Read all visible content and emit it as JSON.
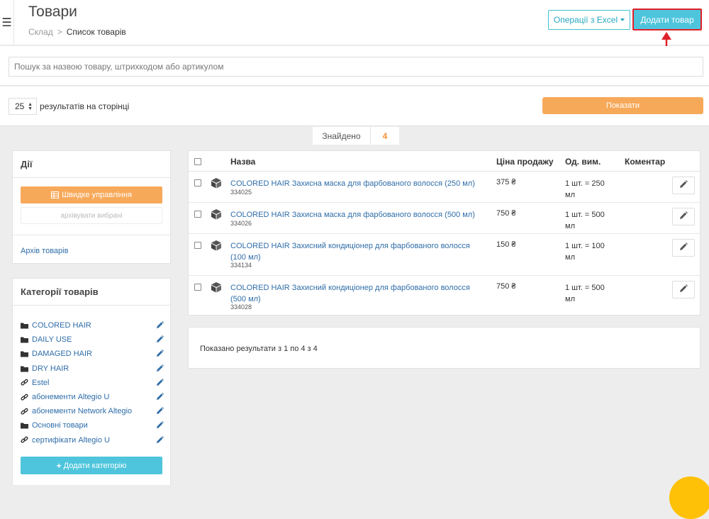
{
  "header": {
    "menu_icon": "hamburger-icon",
    "title": "Товари",
    "breadcrumb": {
      "root": "Склад",
      "separator": ">",
      "current": "Список товарів"
    },
    "excel_label": "Операції з Excel",
    "add_label": "Додати товар"
  },
  "search": {
    "placeholder": "Пошук за назвою товару, штрихкодом або артикулом"
  },
  "pagination": {
    "per_page": "25",
    "per_page_label": "результатів на сторінці",
    "show_label": "Показати"
  },
  "found": {
    "label": "Знайдено",
    "count": "4"
  },
  "actions_panel": {
    "title": "Дії",
    "quick_label": "Швидке управління",
    "archive_selected_label": "архівувати вибрані",
    "archive_link": "Архів товарів"
  },
  "categories_panel": {
    "title": "Категорії товарів",
    "items": [
      {
        "label": "COLORED HAIR",
        "icon": "folder-icon"
      },
      {
        "label": "DAILY USE",
        "icon": "folder-icon"
      },
      {
        "label": "DAMAGED HAIR",
        "icon": "folder-icon"
      },
      {
        "label": "DRY HAIR",
        "icon": "folder-icon"
      },
      {
        "label": "Estel",
        "icon": "link-icon"
      },
      {
        "label": "абонементи Altegio U",
        "icon": "link-icon"
      },
      {
        "label": "абонементи Network Altegio",
        "icon": "link-icon"
      },
      {
        "label": "Основні товари",
        "icon": "folder-icon"
      },
      {
        "label": "сертифікати Altegio U",
        "icon": "link-icon"
      }
    ],
    "add_label": "Додати категорію"
  },
  "table": {
    "columns": {
      "name": "Назва",
      "price": "Ціна продажу",
      "unit": "Од. вим.",
      "comment": "Коментар"
    },
    "rows": [
      {
        "name": "COLORED HAIR Захисна маска для фарбованого волосся (250 мл)",
        "sku": "334025",
        "price": "375 ₴",
        "unit": "1 шт. = 250 мл"
      },
      {
        "name": "COLORED HAIR Захисна маска для фарбованого волосся (500 мл)",
        "sku": "334026",
        "price": "750 ₴",
        "unit": "1 шт. = 500 мл"
      },
      {
        "name": "COLORED HAIR Захисний кондиціонер для фарбованого волосся (100 мл)",
        "sku": "334134",
        "price": "150 ₴",
        "unit": "1 шт. = 100 мл"
      },
      {
        "name": "COLORED HAIR Захисний кондиціонер для фарбованого волосся (500 мл)",
        "sku": "334028",
        "price": "750 ₴",
        "unit": "1 шт. = 500 мл"
      }
    ]
  },
  "summary": {
    "text": "Показано результати з 1 по 4 з 4"
  },
  "colors": {
    "accent_blue": "#4ec5dc",
    "accent_orange": "#f7a95a",
    "link": "#2f6da8",
    "highlight_red": "#e0202a"
  }
}
